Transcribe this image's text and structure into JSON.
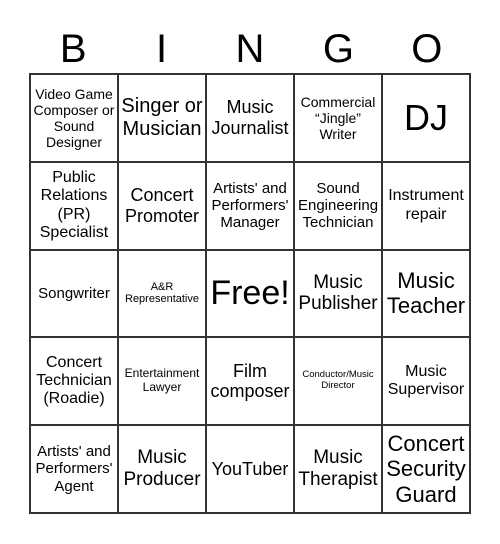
{
  "header": [
    "B",
    "I",
    "N",
    "G",
    "O"
  ],
  "cells": [
    "Video Game Composer or Sound Designer",
    "Singer or Musician",
    "Music Journalist",
    "Commercial “Jingle” Writer",
    "DJ",
    "Public Relations (PR) Specialist",
    "Concert Promoter",
    "Artists' and Performers' Manager",
    "Sound Engineering Technician",
    "Instrument repair",
    "Songwriter",
    "A&R Representative",
    "Free!",
    "Music Publisher",
    "Music Teacher",
    "Concert Technician (Roadie)",
    "Entertainment Lawyer",
    "Film composer",
    "Conductor/Music Director",
    "Music Supervisor",
    "Artists' and Performers' Agent",
    "Music Producer",
    "YouTuber",
    "Music Therapist",
    "Concert Security Guard"
  ]
}
